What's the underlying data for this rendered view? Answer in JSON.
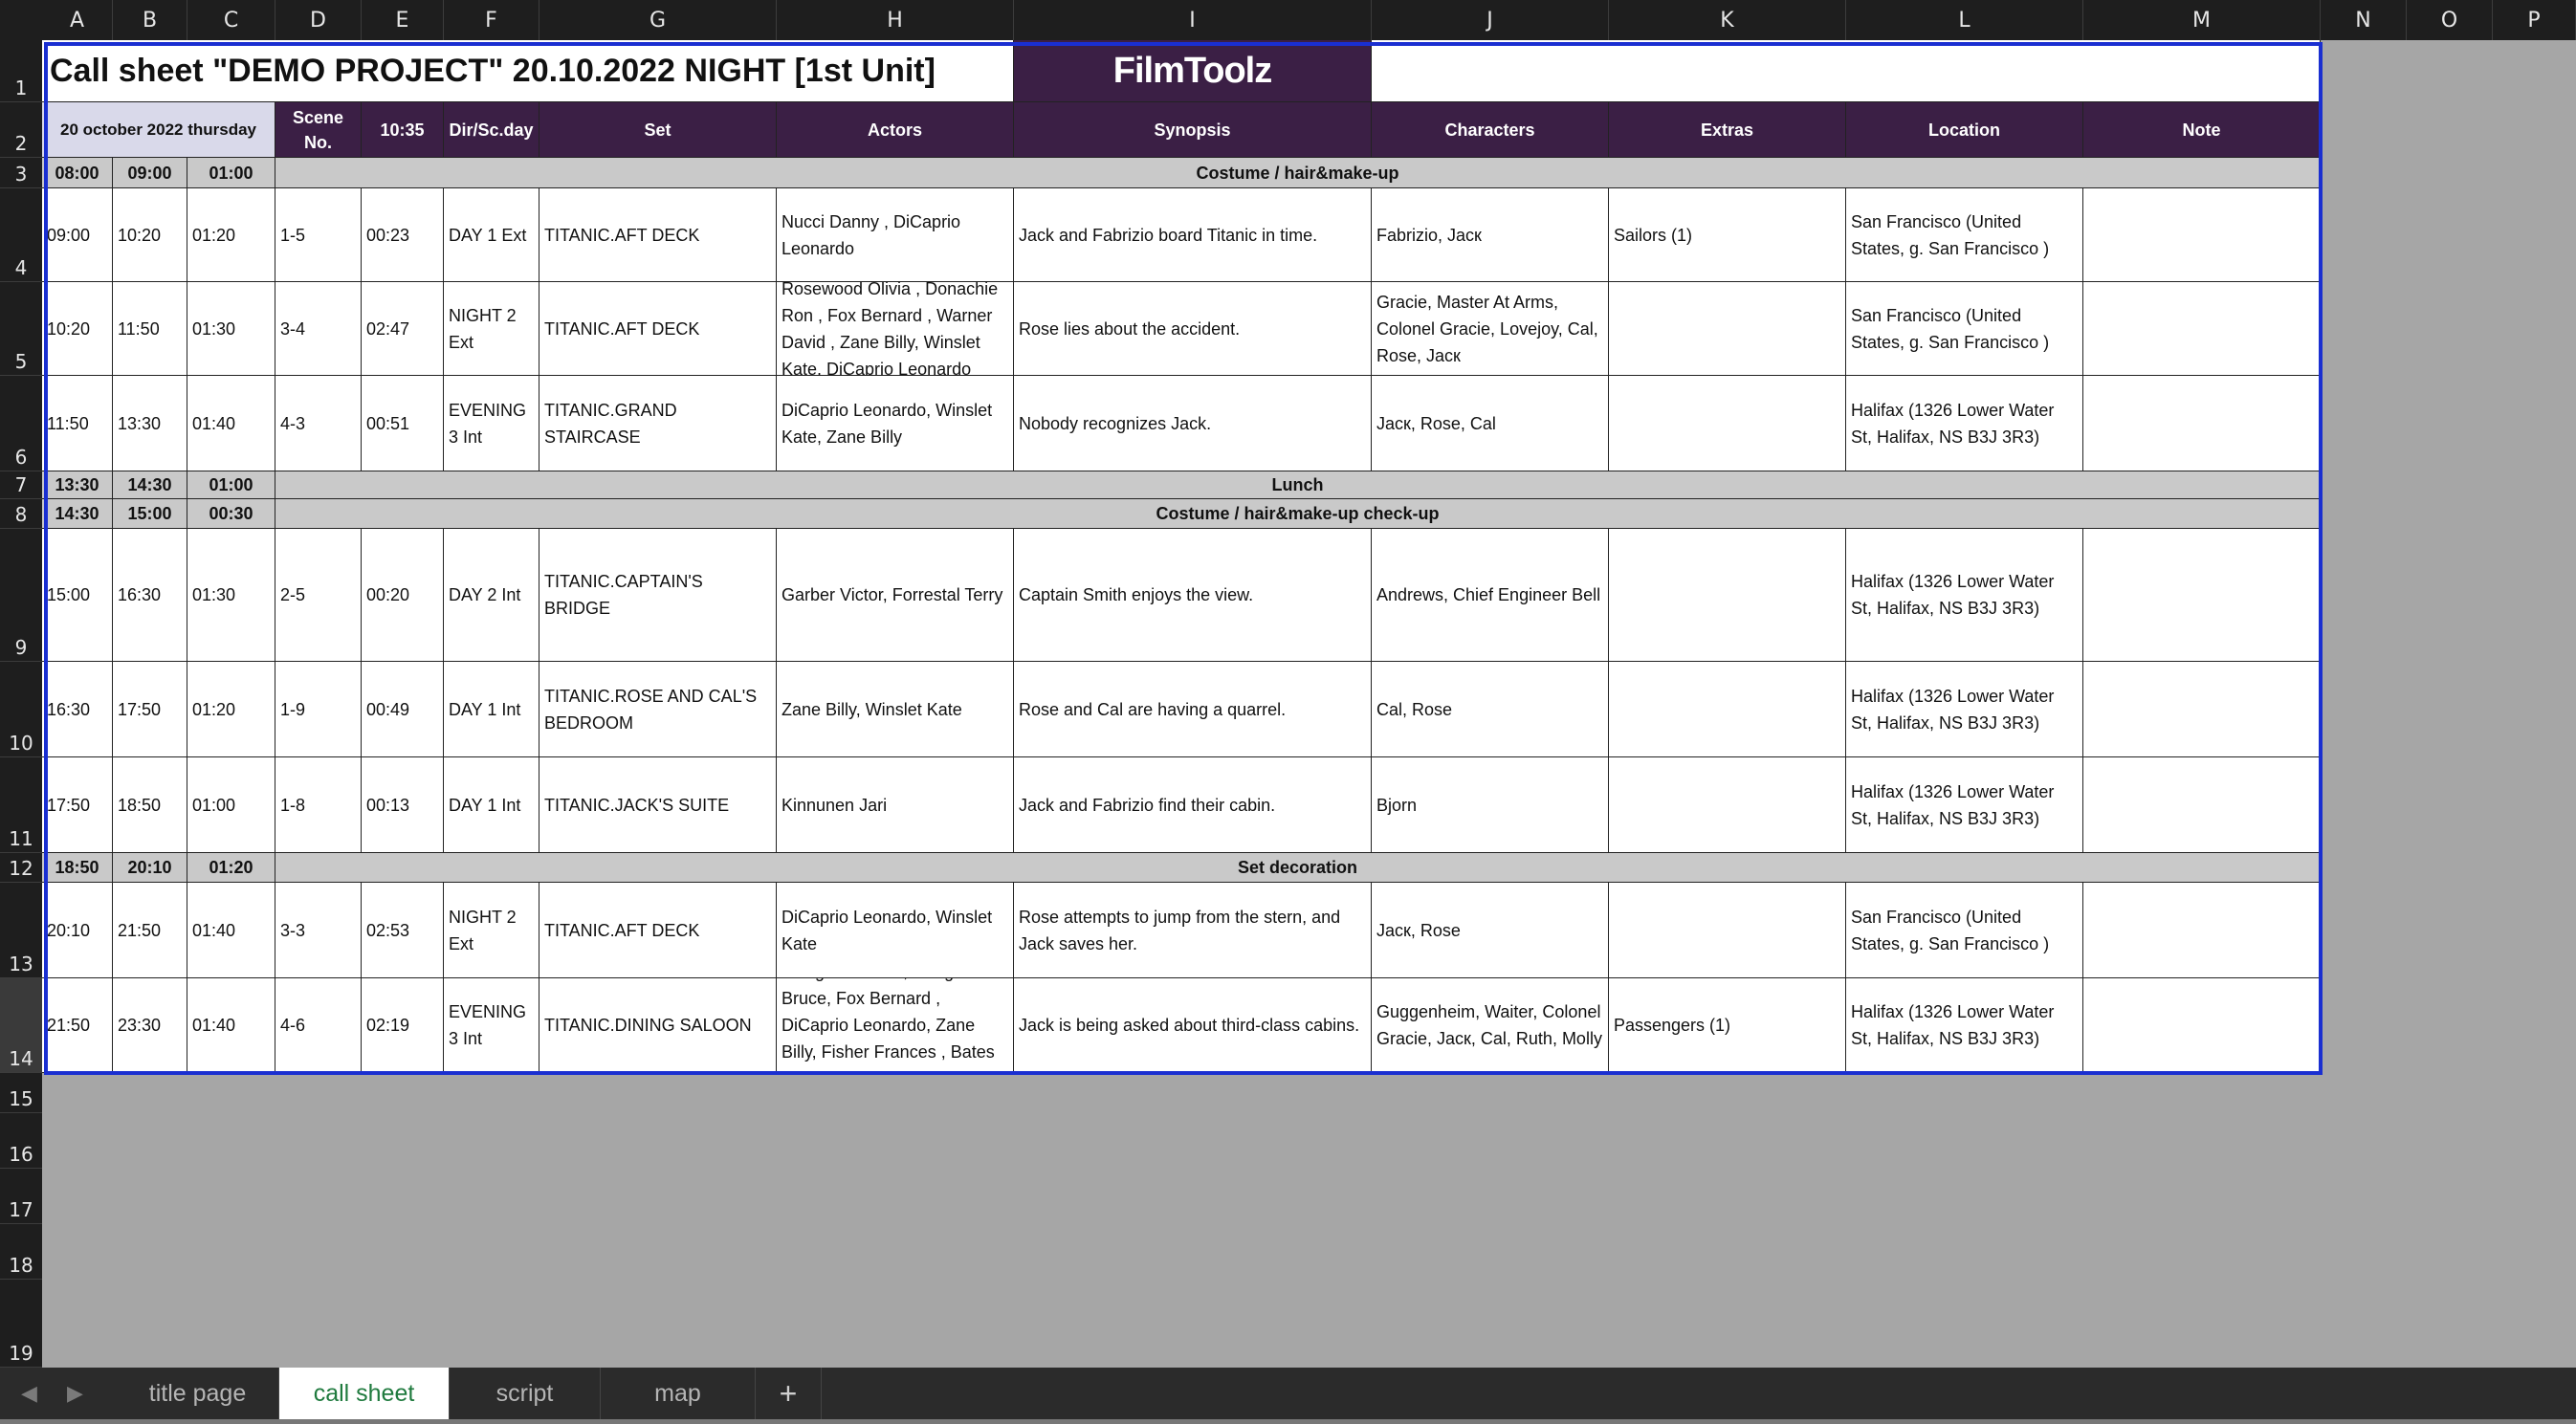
{
  "columns": [
    "A",
    "B",
    "C",
    "D",
    "E",
    "F",
    "G",
    "H",
    "I",
    "J",
    "K",
    "L",
    "M",
    "N",
    "O",
    "P"
  ],
  "rows": [
    "1",
    "2",
    "3",
    "4",
    "5",
    "6",
    "7",
    "8",
    "9",
    "10",
    "11",
    "12",
    "13",
    "14",
    "15",
    "16",
    "17",
    "18",
    "19"
  ],
  "sheet": {
    "title": "Call sheet \"DEMO PROJECT\" 20.10.2022 NIGHT [1st Unit]",
    "logo": "FilmToolz"
  },
  "header": {
    "date": "20 october 2022 thursday",
    "scene_no": "Scene No.",
    "time": "10:35",
    "dir": "Dir/Sc.day",
    "set": "Set",
    "actors": "Actors",
    "synopsis": "Synopsis",
    "characters": "Characters",
    "extras": "Extras",
    "location": "Location",
    "note": "Note"
  },
  "schedule": [
    {
      "type": "break",
      "start": "08:00",
      "end": "09:00",
      "dur": "01:00",
      "label": "Costume / hair&make-up"
    },
    {
      "type": "scene",
      "start": "09:00",
      "end": "10:20",
      "dur": "01:20",
      "scene": "1-5",
      "len": "00:23",
      "dir": "DAY 1 Ext",
      "set": "TITANIC.AFT DECK",
      "actors": "Nucci Danny ,  DiCaprio Leonardo",
      "synopsis": "Jack and Fabrizio board Titanic in time.",
      "characters": "Fabrizio, Јаск",
      "extras": "Sailors (1)",
      "location": "San Francisco  (United States, g. San Francisco )",
      "note": ""
    },
    {
      "type": "scene",
      "start": "10:20",
      "end": "11:50",
      "dur": "01:30",
      "scene": "3-4",
      "len": "02:47",
      "dir": "NIGHT 2 Ext",
      "set": "TITANIC.AFT DECK",
      "actors": "Rosewood Olivia , Donachie Ron , Fox Bernard ,  Warner David ,  Zane Billy,  Winslet Kate,  DiCaprio Leonardo",
      "synopsis": "Rose lies about the accident.",
      "characters": "Gracie, Master At Arms, Colonel Gracie, Lovejoy, Cal, Rose, Јаск",
      "extras": "",
      "location": "San Francisco  (United States, g. San Francisco )",
      "note": ""
    },
    {
      "type": "scene",
      "start": "11:50",
      "end": "13:30",
      "dur": "01:40",
      "scene": "4-3",
      "len": "00:51",
      "dir": "EVENING 3 Int",
      "set": "TITANIC.GRAND STAIRCASE",
      "actors": " DiCaprio Leonardo,  Winslet Kate,  Zane Billy",
      "synopsis": "Nobody recognizes Jack.",
      "characters": "Јаск, Rose, Cal",
      "extras": "",
      "location": "Halifax (1326 Lower Water St, Halifax, NS B3J 3R3)",
      "note": ""
    },
    {
      "type": "break",
      "start": "13:30",
      "end": "14:30",
      "dur": "01:00",
      "label": "Lunch"
    },
    {
      "type": "break",
      "start": "14:30",
      "end": "15:00",
      "dur": "00:30",
      "label": "Costume / hair&make-up check-up"
    },
    {
      "type": "scene",
      "start": "15:00",
      "end": "16:30",
      "dur": "01:30",
      "scene": "2-5",
      "len": "00:20",
      "dir": "DAY 2 Int",
      "set": "TITANIC.CAPTAIN'S BRIDGE",
      "actors": " Garber Victor,  Forrestal Terry",
      "synopsis": "Captain Smith enjoys the view.",
      "characters": "Andrews, Chief Engineer Bell",
      "extras": "",
      "location": "Halifax (1326 Lower Water St, Halifax, NS B3J 3R3)",
      "note": ""
    },
    {
      "type": "scene",
      "start": "16:30",
      "end": "17:50",
      "dur": "01:20",
      "scene": "1-9",
      "len": "00:49",
      "dir": "DAY 1 Int",
      "set": "TITANIC.ROSE AND CAL'S BEDROOM",
      "actors": " Zane Billy,  Winslet Kate",
      "synopsis": "Rose and Cal are having a quarrel.",
      "characters": "Cal, Rose",
      "extras": "",
      "location": "Halifax (1326 Lower Water St, Halifax, NS B3J 3R3)",
      "note": ""
    },
    {
      "type": "scene",
      "start": "17:50",
      "end": "18:50",
      "dur": "01:00",
      "scene": "1-8",
      "len": "00:13",
      "dir": "DAY 1 Int",
      "set": "TITANIC.JACK'S SUITE",
      "actors": "Kinnunen Jari",
      "synopsis": "Jack and Fabrizio find their cabin.",
      "characters": "Bjorn",
      "extras": "",
      "location": "Halifax (1326 Lower Water St, Halifax, NS B3J 3R3)",
      "note": ""
    },
    {
      "type": "break",
      "start": "18:50",
      "end": "20:10",
      "dur": "01:20",
      "label": "Set decoration"
    },
    {
      "type": "scene",
      "start": "20:10",
      "end": "21:50",
      "dur": "01:40",
      "scene": "3-3",
      "len": "02:53",
      "dir": "NIGHT 2 Ext",
      "set": "TITANIC.AFT DECK",
      "actors": " DiCaprio Leonardo,  Winslet Kate",
      "synopsis": "Rose attempts to jump from the stern, and Jack saves her.",
      "characters": "Јаск, Rose",
      "extras": "",
      "location": "San Francisco  (United States, g. San Francisco )",
      "note": ""
    },
    {
      "type": "scene",
      "start": "21:50",
      "end": "23:30",
      "dur": "01:40",
      "scene": "4-6",
      "len": "02:19",
      "dir": "EVENING 3 Int",
      "set": "TITANIC.DINING SALOON",
      "actors": "Ensign Michael ,  Coughran Bruce, Fox Bernard ,  DiCaprio Leonardo,  Zane Billy, Fisher Frances ,  Bates Kathy",
      "synopsis": "Jack is being asked about third-class cabins.",
      "characters": "Guggenheim, Waiter, Colonel Gracie, Јаск, Cal, Ruth, Molly",
      "extras": "Passengers (1)",
      "location": "Halifax (1326 Lower Water St, Halifax, NS B3J 3R3)",
      "note": ""
    }
  ],
  "tabs": [
    {
      "label": "title page",
      "active": false
    },
    {
      "label": "call sheet",
      "active": true
    },
    {
      "label": "script",
      "active": false
    },
    {
      "label": "map",
      "active": false
    }
  ],
  "add_tab": "+",
  "icons": {
    "prev": "chevron-left-icon",
    "next": "chevron-right-icon",
    "add": "plus-icon"
  },
  "colors": {
    "header_bg": "#3b1f45",
    "break_bg": "#c9c9c9",
    "selection": "#1a2fd1",
    "active_tab_text": "#1f7a3e"
  }
}
